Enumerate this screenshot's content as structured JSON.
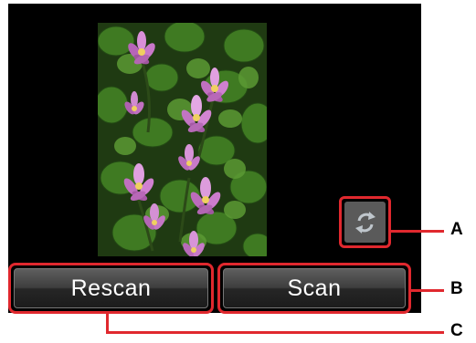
{
  "screen": {
    "preview": {
      "description_icon": "scanned-photo-preview"
    },
    "rotate_button": {
      "icon": "rotate-arrows-icon"
    }
  },
  "buttons": {
    "rescan_label": "Rescan",
    "scan_label": "Scan"
  },
  "callouts": {
    "a": "A",
    "b": "B",
    "c": "C"
  },
  "colors": {
    "callout_red": "#e0282e",
    "screen_bg": "#000000",
    "button_gray": "#3e3e3e"
  }
}
